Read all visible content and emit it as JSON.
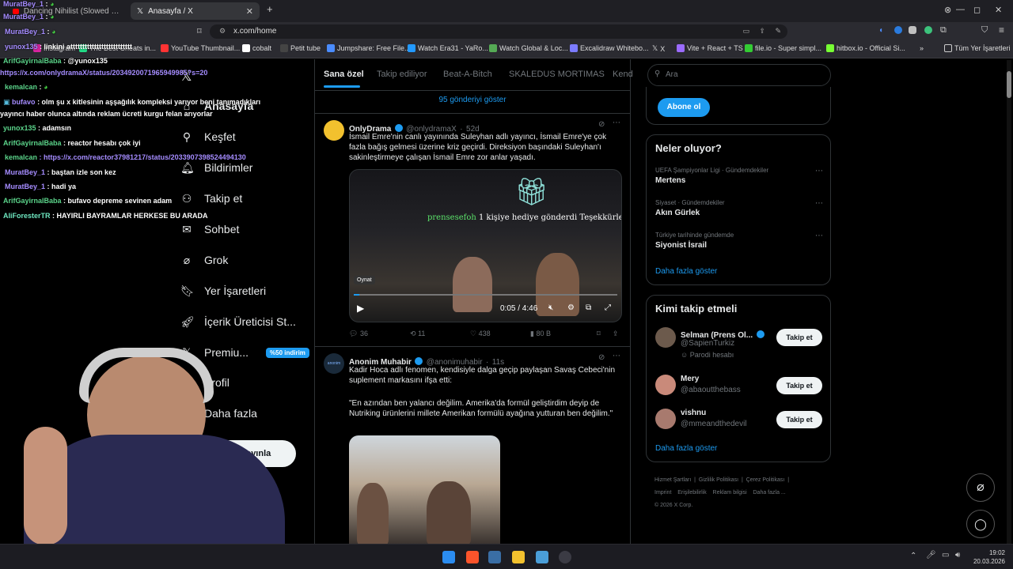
{
  "browser": {
    "tabs": [
      {
        "label": "Dancing Nihilist (Slowed Welly W..."
      },
      {
        "label": "Anasayfa / X"
      }
    ],
    "url": "x.com/home",
    "bookmarks": [
      "Instagram",
      "The Best Cheats in...",
      "YouTube Thumbnail...",
      "cobalt",
      "Petit tube",
      "Jumpshare: Free File...",
      "Watch Era31 - YaRo...",
      "Watch Global & Loc...",
      "Excalidraw Whitebo...",
      "X",
      "Vite + React + TS",
      "file.io - Super simpl...",
      "hitbox.io - Official Si..."
    ],
    "all_bookmarks": "Tüm Yer İşaretleri"
  },
  "nav": {
    "items": [
      {
        "label": "Anasayfa",
        "icon": "home-icon"
      },
      {
        "label": "Keşfet",
        "icon": "search-icon"
      },
      {
        "label": "Bildirimler",
        "icon": "bell-icon"
      },
      {
        "label": "Takip et",
        "icon": "person-plus-icon"
      },
      {
        "label": "Sohbet",
        "icon": "mail-icon"
      },
      {
        "label": "Grok",
        "icon": "grok-icon"
      },
      {
        "label": "Yer İşaretleri",
        "icon": "bookmark-icon"
      },
      {
        "label": "İçerik Üreticisi St...",
        "icon": "rocket-icon"
      },
      {
        "label": "Premiu...",
        "icon": "x-logo-icon"
      },
      {
        "label": "Profil",
        "icon": "profile-icon"
      },
      {
        "label": "Daha fazla",
        "icon": "more-icon"
      }
    ],
    "premium_badge": "%50 indirim",
    "post_button": "Gönderi yayınla"
  },
  "feed": {
    "tabs": [
      "Sana özel",
      "Takip ediliyor",
      "Beat-A-Bitch",
      "SKALEDUS MORTIMAS",
      "Kend"
    ],
    "show_more": "95 gönderiyi göster",
    "post1": {
      "name": "OnlyDrama",
      "handle": "@onlydramaX",
      "time": "52d",
      "text": "İsmail Emre'nin canlı yayınında Suleyhan adlı yayıncı, İsmail Emre'ye çok fazla bağış gelmesi üzerine kriz geçirdi. Direksiyon başındaki Suleyhan'ı sakinleştirmeye çalışan İsmail Emre zor anlar yaşadı.",
      "video_overlay_user": "prensesefoh",
      "video_overlay_text": "1 kişiye hediye gönderdi Teşekkürler",
      "tooltip": "Oynat",
      "time_display": "0:05 / 4:46",
      "replies": "36",
      "reposts": "11",
      "likes": "438",
      "views": "80 B"
    },
    "post2": {
      "name": "Anonim Muhabir",
      "handle": "@anonimuhabir",
      "time": "11s",
      "avatar_text": "anonim",
      "text1": "Kadir Hoca adlı fenomen, kendisiyle dalga geçip paylaşan Savaş Cebeci'nin suplement markasını ifşa etti:",
      "text2": "\"En azından ben yalancı değilim. Amerika'da formül geliştirdim deyip de Nutriking ürünlerini millete Amerikan formülü ayağına yutturan ben değilim.\""
    }
  },
  "right": {
    "search_placeholder": "Ara",
    "subscribe": "Abone ol",
    "trends_title": "Neler oluyor?",
    "trends": [
      {
        "sub": "UEFA Şampiyonlar Ligi · Gündemdekiler",
        "title": "Mertens"
      },
      {
        "sub": "Siyaset · Gündemdekiler",
        "title": "Akın Gürlek"
      },
      {
        "sub": "Türkiye tarihinde gündemde",
        "title": "Siyonist İsrail"
      }
    ],
    "trends_more": "Daha fazla göster",
    "follow_title": "Kimi takip etmeli",
    "follows": [
      {
        "name": "Selman (Prens Ol...",
        "handle": "@SapienTurkiz",
        "extra": "Parodi hesabı",
        "button": "Takip et"
      },
      {
        "name": "Mery",
        "handle": "@abaoutthebass",
        "extra": "",
        "button": "Takip et"
      },
      {
        "name": "vishnu",
        "handle": "@mmeandthedevil",
        "extra": "",
        "button": "Takip et"
      }
    ],
    "follow_more": "Daha fazla göster",
    "footer": [
      "Hizmet Şartları",
      "Gizlilik Politikası",
      "Çerez Politikası",
      "Imprint",
      "Erişilebilirlik",
      "Reklam bilgisi",
      "Daha fazla ...",
      "© 2026 X Corp."
    ]
  },
  "chat": [
    {
      "user": "MuratBey_1",
      "msg": ":"
    },
    {
      "user": "MuratBey_1",
      "msg": ":"
    },
    {
      "user": "MuratBey_1",
      "msg": ":"
    },
    {
      "user": "yunox135",
      "msg": ": linkini atttttttttttttttttttttttttt"
    },
    {
      "user": "ArifGayirnalBaba",
      "msg": ": @yunox135"
    },
    {
      "user": "",
      "msg": "https://x.com/onlydramaX/status/2034920071965949985?s=20"
    },
    {
      "user": "kemalcan",
      "msg": ":"
    },
    {
      "user": "bufavo",
      "msg": ": olm şu x kitlesinin aşşağılık kompleksi yarıyor beni tanımadıkları"
    },
    {
      "user": "",
      "msg": "yayıncı haber olunca altında reklam ücreti kurgu felan arıyorlar"
    },
    {
      "user": "yunox135",
      "msg": ": adamsın"
    },
    {
      "user": "ArifGayirnalBaba",
      "msg": ": reactor hesabı çok iyi"
    },
    {
      "user": "kemalcan",
      "msg": ": https://x.com/reactor37981217/status/2033907398524494130"
    },
    {
      "user": "MuratBey_1",
      "msg": ": baştan izle son kez"
    },
    {
      "user": "MuratBey_1",
      "msg": ": hadi ya"
    },
    {
      "user": "ArifGayirnalBaba",
      "msg": ": bufavo depreme sevinen adam"
    },
    {
      "user": "AliForesterTR",
      "msg": ": HAYIRLI BAYRAMLAR HERKESE BU ARADA"
    }
  ],
  "taskbar": {
    "time": "19:02",
    "date": "20.03.2026"
  }
}
